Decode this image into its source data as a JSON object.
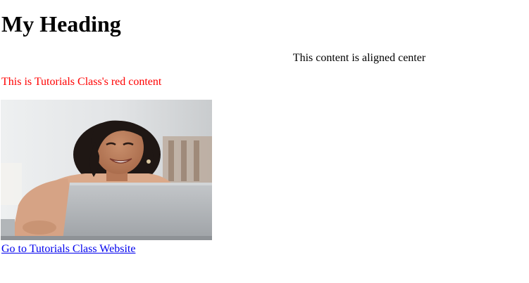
{
  "page": {
    "heading": "My Heading",
    "centered_text": "This content is aligned center",
    "red_text": "This is Tutorials Class's red content",
    "link_text": "Go to Tutorials Class Website"
  },
  "image": {
    "subject": "smiling woman using a laptop"
  },
  "colors": {
    "red_text": "#ff0000",
    "link": "#0000ee"
  }
}
